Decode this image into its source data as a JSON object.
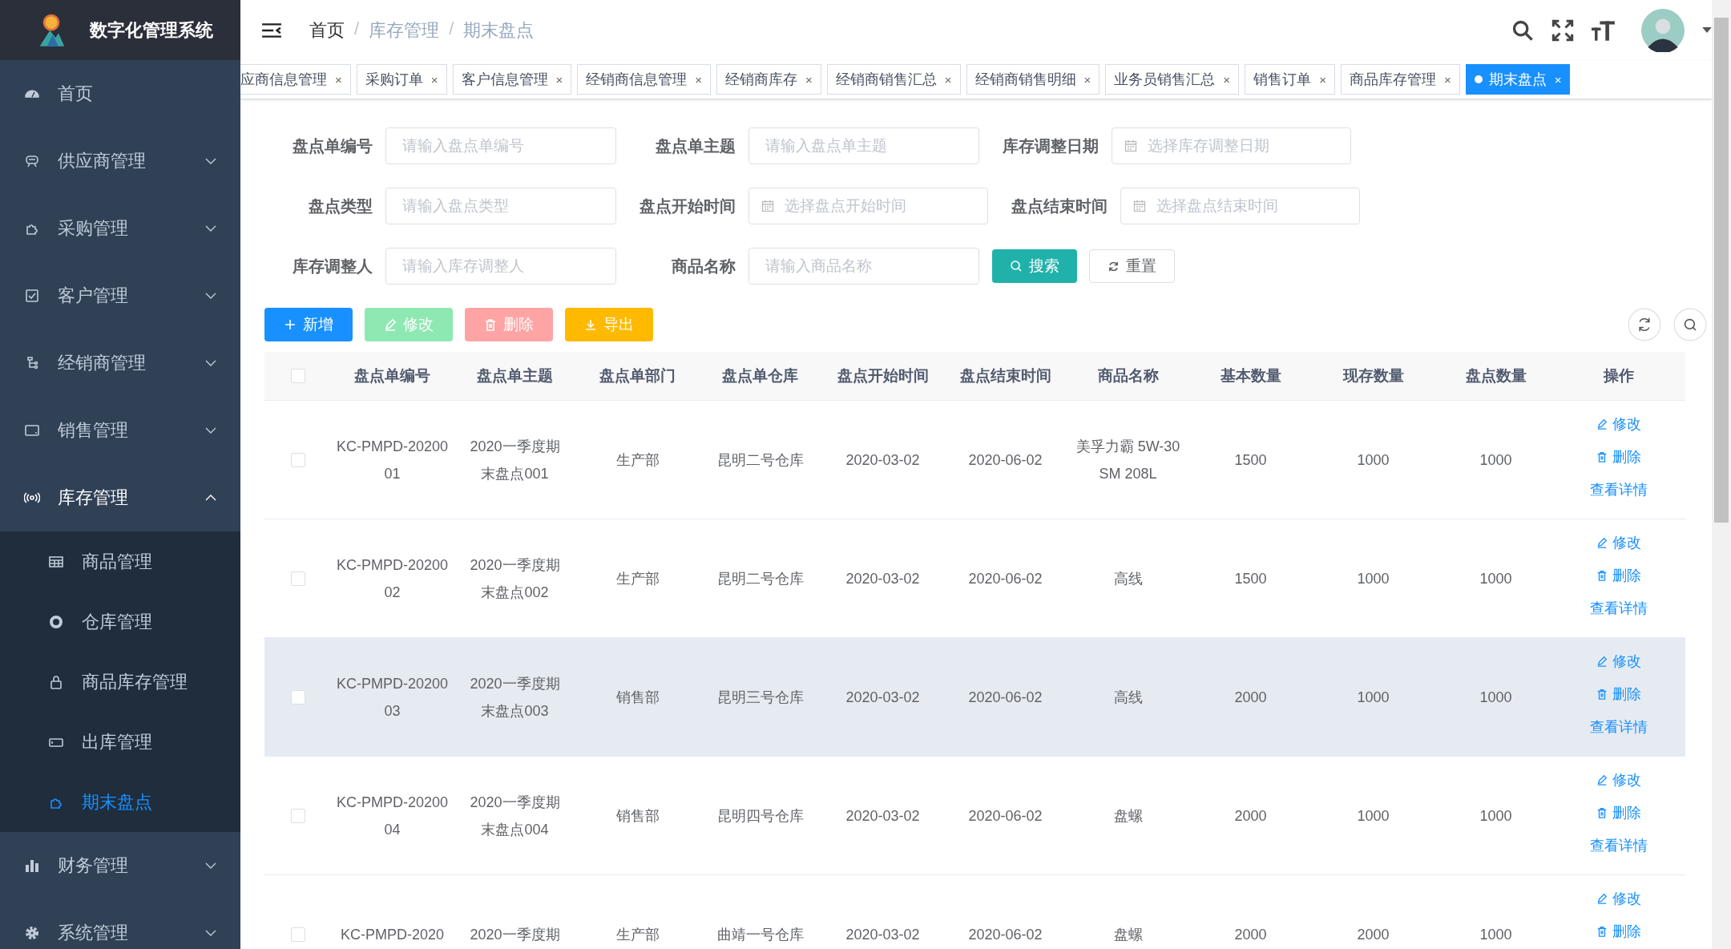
{
  "sidebar": {
    "logo_title": "数字化管理系统",
    "items": [
      {
        "label": "首页"
      },
      {
        "label": "供应商管理",
        "expanded": false
      },
      {
        "label": "采购管理",
        "expanded": false
      },
      {
        "label": "客户管理",
        "expanded": false
      },
      {
        "label": "经销商管理",
        "expanded": false
      },
      {
        "label": "销售管理",
        "expanded": false
      },
      {
        "label": "库存管理",
        "expanded": true,
        "children": [
          {
            "label": "商品管理",
            "selected": false
          },
          {
            "label": "仓库管理",
            "selected": false
          },
          {
            "label": "商品库存管理",
            "selected": false
          },
          {
            "label": "出库管理",
            "selected": false
          },
          {
            "label": "期末盘点",
            "selected": true
          }
        ]
      },
      {
        "label": "财务管理",
        "expanded": false
      },
      {
        "label": "系统管理",
        "expanded": false
      }
    ]
  },
  "breadcrumb": [
    {
      "label": "首页"
    },
    {
      "separator": "/",
      "label": "库存管理"
    },
    {
      "separator": "/",
      "label": "期末盘点"
    }
  ],
  "tabs": [
    {
      "label": "应商信息管理",
      "close": "×",
      "selected": false
    },
    {
      "label": "采购订单",
      "close": "×",
      "selected": false
    },
    {
      "label": "客户信息管理",
      "close": "×",
      "selected": false
    },
    {
      "label": "经销商信息管理",
      "close": "×",
      "selected": false
    },
    {
      "label": "经销商库存",
      "close": "×",
      "selected": false
    },
    {
      "label": "经销商销售汇总",
      "close": "×",
      "selected": false
    },
    {
      "label": "经销商销售明细",
      "close": "×",
      "selected": false
    },
    {
      "label": "业务员销售汇总",
      "close": "×",
      "selected": false
    },
    {
      "label": "销售订单",
      "close": "×",
      "selected": false
    },
    {
      "label": "商品库存管理",
      "close": "×",
      "selected": false
    },
    {
      "label": "期末盘点",
      "close": "×",
      "selected": true
    }
  ],
  "filters": [
    {
      "label": "盘点单编号",
      "placeholder": "请输入盘点单编号",
      "kind": "text"
    },
    {
      "label": "盘点单主题",
      "placeholder": "请输入盘点单主题",
      "kind": "text"
    },
    {
      "label": "库存调整日期",
      "placeholder": "选择库存调整日期",
      "kind": "date"
    },
    {
      "label": "盘点类型",
      "placeholder": "请输入盘点类型",
      "kind": "text"
    },
    {
      "label": "盘点开始时间",
      "placeholder": "选择盘点开始时间",
      "kind": "date"
    },
    {
      "label": "盘点结束时间",
      "placeholder": "选择盘点结束时间",
      "kind": "date"
    },
    {
      "label": "库存调整人",
      "placeholder": "请输入库存调整人",
      "kind": "text"
    },
    {
      "label": "商品名称",
      "placeholder": "请输入商品名称",
      "kind": "text"
    }
  ],
  "search_button": "搜索",
  "reset_button": "重置",
  "toolbar": [
    {
      "label": "新增",
      "kind": "add",
      "disabled": false
    },
    {
      "label": "修改",
      "kind": "edit",
      "disabled": true
    },
    {
      "label": "删除",
      "kind": "delete",
      "disabled": true
    },
    {
      "label": "导出",
      "kind": "export",
      "disabled": false
    }
  ],
  "table": {
    "all_checked": false,
    "columns": [
      "盘点单编号",
      "盘点单主题",
      "盘点单部门",
      "盘点单仓库",
      "盘点开始时间",
      "盘点结束时间",
      "商品名称",
      "基本数量",
      "现存数量",
      "盘点数量",
      "操作"
    ],
    "rows": [
      {
        "checked": false,
        "highlighted": false,
        "cells": [
          "KC-PMPD-2020001",
          "2020一季度期末盘点001",
          "生产部",
          "昆明二号仓库",
          "2020-03-02",
          "2020-06-02",
          "美孚力霸 5W-30 SM 208L",
          "1500",
          "1000",
          "1000"
        ],
        "actions": [
          "修改",
          "删除",
          "查看详情"
        ]
      },
      {
        "checked": false,
        "highlighted": false,
        "cells": [
          "KC-PMPD-2020002",
          "2020一季度期末盘点002",
          "生产部",
          "昆明二号仓库",
          "2020-03-02",
          "2020-06-02",
          "高线",
          "1500",
          "1000",
          "1000"
        ],
        "actions": [
          "修改",
          "删除",
          "查看详情"
        ]
      },
      {
        "checked": false,
        "highlighted": true,
        "cells": [
          "KC-PMPD-2020003",
          "2020一季度期末盘点003",
          "销售部",
          "昆明三号仓库",
          "2020-03-02",
          "2020-06-02",
          "高线",
          "2000",
          "1000",
          "1000"
        ],
        "actions": [
          "修改",
          "删除",
          "查看详情"
        ]
      },
      {
        "checked": false,
        "highlighted": false,
        "cells": [
          "KC-PMPD-2020004",
          "2020一季度期末盘点004",
          "销售部",
          "昆明四号仓库",
          "2020-03-02",
          "2020-06-02",
          "盘螺",
          "2000",
          "1000",
          "1000"
        ],
        "actions": [
          "修改",
          "删除",
          "查看详情"
        ]
      },
      {
        "checked": false,
        "highlighted": false,
        "cells": [
          "KC-PMPD-2020",
          "2020一季度期",
          "生产部",
          "曲靖一号仓库",
          "2020-03-02",
          "2020-06-02",
          "盘螺",
          "2000",
          "2000",
          "1000"
        ],
        "actions": [
          "修改",
          "删除"
        ]
      }
    ]
  }
}
